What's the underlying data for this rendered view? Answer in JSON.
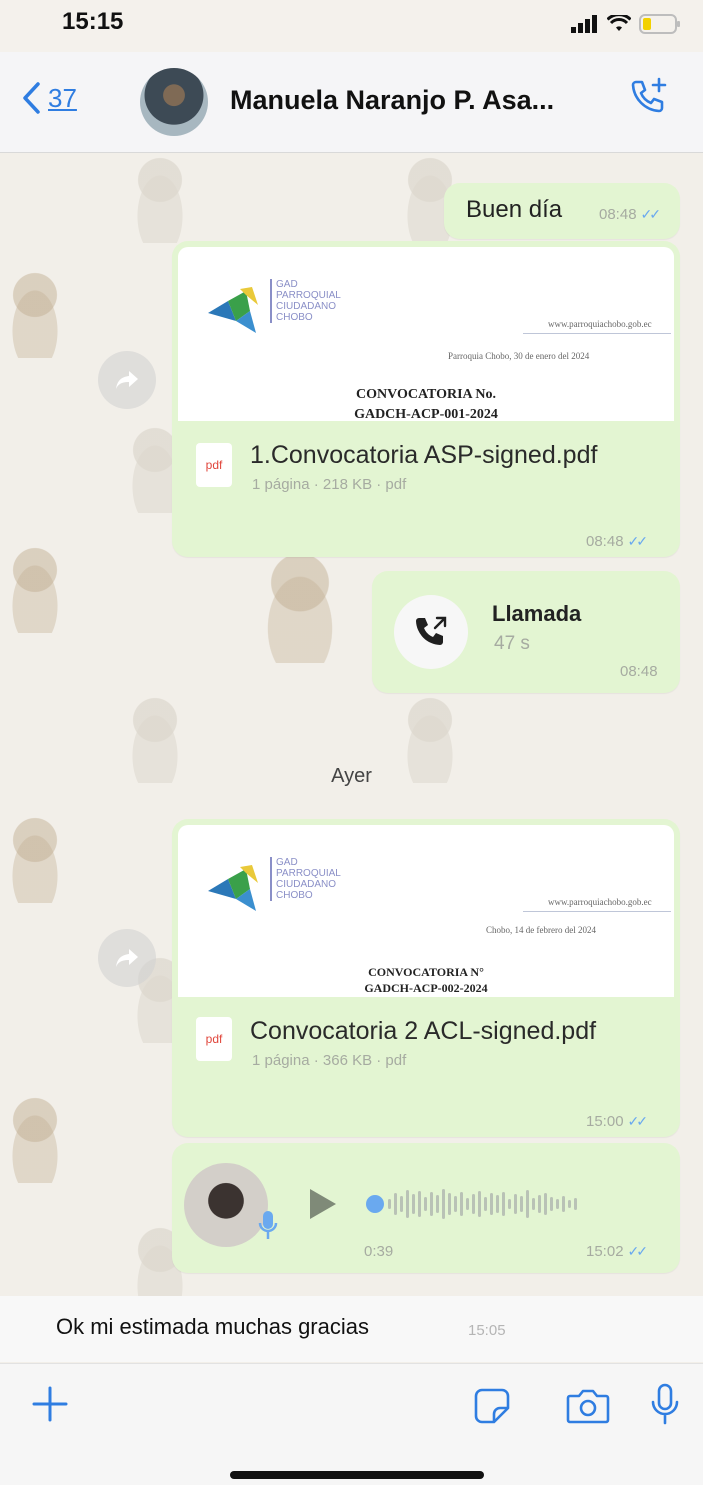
{
  "status": {
    "time": "15:15"
  },
  "header": {
    "back_count": "37",
    "contact_name": "Manuela Naranjo P. Asa..."
  },
  "messages": {
    "greeting": {
      "text": "Buen día",
      "time": "08:48"
    },
    "doc1": {
      "logo_lines": [
        "GAD",
        "PARROQUIAL",
        "CIUDADANO",
        "CHOBO"
      ],
      "website": "www.parroquiachobo.gob.ec",
      "date_line": "Parroquia Chobo, 30 de enero del 2024",
      "heading": "CONVOCATORIA No.",
      "subheading": "GADCH-ACP-001-2024",
      "file_name": "1.Convocatoria ASP-signed.pdf",
      "file_meta": "1 página · 218 KB · pdf",
      "pdf_label": "pdf",
      "time": "08:48"
    },
    "call": {
      "label": "Llamada",
      "duration": "47 s",
      "time": "08:48"
    },
    "day_separator": "Ayer",
    "doc2": {
      "logo_lines": [
        "GAD",
        "PARROQUIAL",
        "CIUDADANO",
        "CHOBO"
      ],
      "website": "www.parroquiachobo.gob.ec",
      "date_line": "Chobo, 14 de febrero del 2024",
      "heading": "CONVOCATORIA N°",
      "subheading": "GADCH-ACP-002-2024",
      "file_name": "Convocatoria 2 ACL-signed.pdf",
      "file_meta": "1 página · 366 KB · pdf",
      "pdf_label": "pdf",
      "time": "15:00"
    },
    "voice": {
      "duration": "0:39",
      "time": "15:02"
    },
    "incoming": {
      "text": "Ok mi estimada muchas gracias",
      "time": "15:05"
    }
  },
  "icons": {
    "back": "chevron-left-icon",
    "call_add": "phone-plus-icon",
    "attach": "plus-icon",
    "sticker": "sticker-icon",
    "camera": "camera-icon",
    "mic": "microphone-icon"
  },
  "colors": {
    "accent": "#2f7de1",
    "outgoing_bubble": "#e3f5d2",
    "read_tick": "#6aa9ef"
  }
}
